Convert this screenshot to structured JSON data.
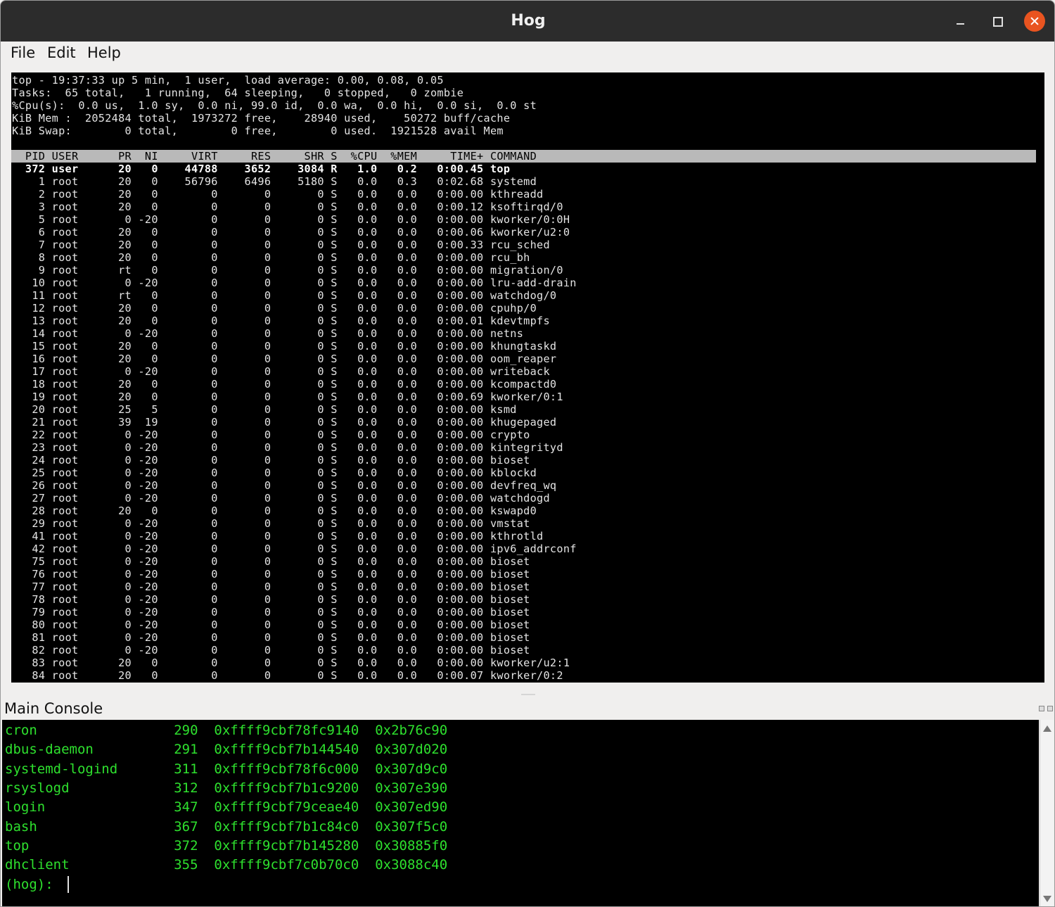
{
  "window": {
    "title": "Hog",
    "menu": [
      "File",
      "Edit",
      "Help"
    ]
  },
  "top_output": {
    "summary": [
      "top - 19:37:33 up 5 min,  1 user,  load average: 0.00, 0.08, 0.05",
      "Tasks:  65 total,   1 running,  64 sleeping,   0 stopped,   0 zombie",
      "%Cpu(s):  0.0 us,  1.0 sy,  0.0 ni, 99.0 id,  0.0 wa,  0.0 hi,  0.0 si,  0.0 st",
      "KiB Mem :  2052484 total,  1973272 free,    28940 used,    50272 buff/cache",
      "KiB Swap:        0 total,        0 free,        0 used.  1921528 avail Mem"
    ],
    "columns": [
      "PID",
      "USER",
      "PR",
      "NI",
      "VIRT",
      "RES",
      "SHR",
      "S",
      "%CPU",
      "%MEM",
      "TIME+",
      "COMMAND"
    ],
    "rows": [
      [
        "372",
        "user",
        "20",
        "0",
        "44788",
        "3652",
        "3084",
        "R",
        "1.0",
        "0.2",
        "0:00.45",
        "top"
      ],
      [
        "1",
        "root",
        "20",
        "0",
        "56796",
        "6496",
        "5180",
        "S",
        "0.0",
        "0.3",
        "0:02.68",
        "systemd"
      ],
      [
        "2",
        "root",
        "20",
        "0",
        "0",
        "0",
        "0",
        "S",
        "0.0",
        "0.0",
        "0:00.00",
        "kthreadd"
      ],
      [
        "3",
        "root",
        "20",
        "0",
        "0",
        "0",
        "0",
        "S",
        "0.0",
        "0.0",
        "0:00.12",
        "ksoftirqd/0"
      ],
      [
        "5",
        "root",
        "0",
        "-20",
        "0",
        "0",
        "0",
        "S",
        "0.0",
        "0.0",
        "0:00.00",
        "kworker/0:0H"
      ],
      [
        "6",
        "root",
        "20",
        "0",
        "0",
        "0",
        "0",
        "S",
        "0.0",
        "0.0",
        "0:00.06",
        "kworker/u2:0"
      ],
      [
        "7",
        "root",
        "20",
        "0",
        "0",
        "0",
        "0",
        "S",
        "0.0",
        "0.0",
        "0:00.33",
        "rcu_sched"
      ],
      [
        "8",
        "root",
        "20",
        "0",
        "0",
        "0",
        "0",
        "S",
        "0.0",
        "0.0",
        "0:00.00",
        "rcu_bh"
      ],
      [
        "9",
        "root",
        "rt",
        "0",
        "0",
        "0",
        "0",
        "S",
        "0.0",
        "0.0",
        "0:00.00",
        "migration/0"
      ],
      [
        "10",
        "root",
        "0",
        "-20",
        "0",
        "0",
        "0",
        "S",
        "0.0",
        "0.0",
        "0:00.00",
        "lru-add-drain"
      ],
      [
        "11",
        "root",
        "rt",
        "0",
        "0",
        "0",
        "0",
        "S",
        "0.0",
        "0.0",
        "0:00.00",
        "watchdog/0"
      ],
      [
        "12",
        "root",
        "20",
        "0",
        "0",
        "0",
        "0",
        "S",
        "0.0",
        "0.0",
        "0:00.00",
        "cpuhp/0"
      ],
      [
        "13",
        "root",
        "20",
        "0",
        "0",
        "0",
        "0",
        "S",
        "0.0",
        "0.0",
        "0:00.01",
        "kdevtmpfs"
      ],
      [
        "14",
        "root",
        "0",
        "-20",
        "0",
        "0",
        "0",
        "S",
        "0.0",
        "0.0",
        "0:00.00",
        "netns"
      ],
      [
        "15",
        "root",
        "20",
        "0",
        "0",
        "0",
        "0",
        "S",
        "0.0",
        "0.0",
        "0:00.00",
        "khungtaskd"
      ],
      [
        "16",
        "root",
        "20",
        "0",
        "0",
        "0",
        "0",
        "S",
        "0.0",
        "0.0",
        "0:00.00",
        "oom_reaper"
      ],
      [
        "17",
        "root",
        "0",
        "-20",
        "0",
        "0",
        "0",
        "S",
        "0.0",
        "0.0",
        "0:00.00",
        "writeback"
      ],
      [
        "18",
        "root",
        "20",
        "0",
        "0",
        "0",
        "0",
        "S",
        "0.0",
        "0.0",
        "0:00.00",
        "kcompactd0"
      ],
      [
        "19",
        "root",
        "20",
        "0",
        "0",
        "0",
        "0",
        "S",
        "0.0",
        "0.0",
        "0:00.69",
        "kworker/0:1"
      ],
      [
        "20",
        "root",
        "25",
        "5",
        "0",
        "0",
        "0",
        "S",
        "0.0",
        "0.0",
        "0:00.00",
        "ksmd"
      ],
      [
        "21",
        "root",
        "39",
        "19",
        "0",
        "0",
        "0",
        "S",
        "0.0",
        "0.0",
        "0:00.00",
        "khugepaged"
      ],
      [
        "22",
        "root",
        "0",
        "-20",
        "0",
        "0",
        "0",
        "S",
        "0.0",
        "0.0",
        "0:00.00",
        "crypto"
      ],
      [
        "23",
        "root",
        "0",
        "-20",
        "0",
        "0",
        "0",
        "S",
        "0.0",
        "0.0",
        "0:00.00",
        "kintegrityd"
      ],
      [
        "24",
        "root",
        "0",
        "-20",
        "0",
        "0",
        "0",
        "S",
        "0.0",
        "0.0",
        "0:00.00",
        "bioset"
      ],
      [
        "25",
        "root",
        "0",
        "-20",
        "0",
        "0",
        "0",
        "S",
        "0.0",
        "0.0",
        "0:00.00",
        "kblockd"
      ],
      [
        "26",
        "root",
        "0",
        "-20",
        "0",
        "0",
        "0",
        "S",
        "0.0",
        "0.0",
        "0:00.00",
        "devfreq_wq"
      ],
      [
        "27",
        "root",
        "0",
        "-20",
        "0",
        "0",
        "0",
        "S",
        "0.0",
        "0.0",
        "0:00.00",
        "watchdogd"
      ],
      [
        "28",
        "root",
        "20",
        "0",
        "0",
        "0",
        "0",
        "S",
        "0.0",
        "0.0",
        "0:00.00",
        "kswapd0"
      ],
      [
        "29",
        "root",
        "0",
        "-20",
        "0",
        "0",
        "0",
        "S",
        "0.0",
        "0.0",
        "0:00.00",
        "vmstat"
      ],
      [
        "41",
        "root",
        "0",
        "-20",
        "0",
        "0",
        "0",
        "S",
        "0.0",
        "0.0",
        "0:00.00",
        "kthrotld"
      ],
      [
        "42",
        "root",
        "0",
        "-20",
        "0",
        "0",
        "0",
        "S",
        "0.0",
        "0.0",
        "0:00.00",
        "ipv6_addrconf"
      ],
      [
        "75",
        "root",
        "0",
        "-20",
        "0",
        "0",
        "0",
        "S",
        "0.0",
        "0.0",
        "0:00.00",
        "bioset"
      ],
      [
        "76",
        "root",
        "0",
        "-20",
        "0",
        "0",
        "0",
        "S",
        "0.0",
        "0.0",
        "0:00.00",
        "bioset"
      ],
      [
        "77",
        "root",
        "0",
        "-20",
        "0",
        "0",
        "0",
        "S",
        "0.0",
        "0.0",
        "0:00.00",
        "bioset"
      ],
      [
        "78",
        "root",
        "0",
        "-20",
        "0",
        "0",
        "0",
        "S",
        "0.0",
        "0.0",
        "0:00.00",
        "bioset"
      ],
      [
        "79",
        "root",
        "0",
        "-20",
        "0",
        "0",
        "0",
        "S",
        "0.0",
        "0.0",
        "0:00.00",
        "bioset"
      ],
      [
        "80",
        "root",
        "0",
        "-20",
        "0",
        "0",
        "0",
        "S",
        "0.0",
        "0.0",
        "0:00.00",
        "bioset"
      ],
      [
        "81",
        "root",
        "0",
        "-20",
        "0",
        "0",
        "0",
        "S",
        "0.0",
        "0.0",
        "0:00.00",
        "bioset"
      ],
      [
        "82",
        "root",
        "0",
        "-20",
        "0",
        "0",
        "0",
        "S",
        "0.0",
        "0.0",
        "0:00.00",
        "bioset"
      ],
      [
        "83",
        "root",
        "20",
        "0",
        "0",
        "0",
        "0",
        "S",
        "0.0",
        "0.0",
        "0:00.00",
        "kworker/u2:1"
      ],
      [
        "84",
        "root",
        "20",
        "0",
        "0",
        "0",
        "0",
        "S",
        "0.0",
        "0.0",
        "0:00.07",
        "kworker/0:2"
      ]
    ]
  },
  "console": {
    "title": "Main Console",
    "rows": [
      [
        "cron",
        "290",
        "0xffff9cbf78fc9140",
        "0x2b76c90"
      ],
      [
        "dbus-daemon",
        "291",
        "0xffff9cbf7b144540",
        "0x307d020"
      ],
      [
        "systemd-logind",
        "311",
        "0xffff9cbf78f6c000",
        "0x307d9c0"
      ],
      [
        "rsyslogd",
        "312",
        "0xffff9cbf7b1c9200",
        "0x307e390"
      ],
      [
        "login",
        "347",
        "0xffff9cbf79ceae40",
        "0x307ed90"
      ],
      [
        "bash",
        "367",
        "0xffff9cbf7b1c84c0",
        "0x307f5c0"
      ],
      [
        "top",
        "372",
        "0xffff9cbf7b145280",
        "0x30885f0"
      ],
      [
        "dhclient",
        "355",
        "0xffff9cbf7c0b70c0",
        "0x3088c40"
      ]
    ],
    "prompt": "(hog): "
  },
  "colors": {
    "titlebar": "#2c2c2c",
    "close_button": "#e95420",
    "terminal_bg": "#000000",
    "top_text": "#e4e4e4",
    "header_bar": "#b9b9b9",
    "console_text": "#2ee02e"
  },
  "icons": [
    "minimize-icon",
    "maximize-icon",
    "close-icon",
    "scroll-up-icon",
    "scroll-down-icon"
  ]
}
